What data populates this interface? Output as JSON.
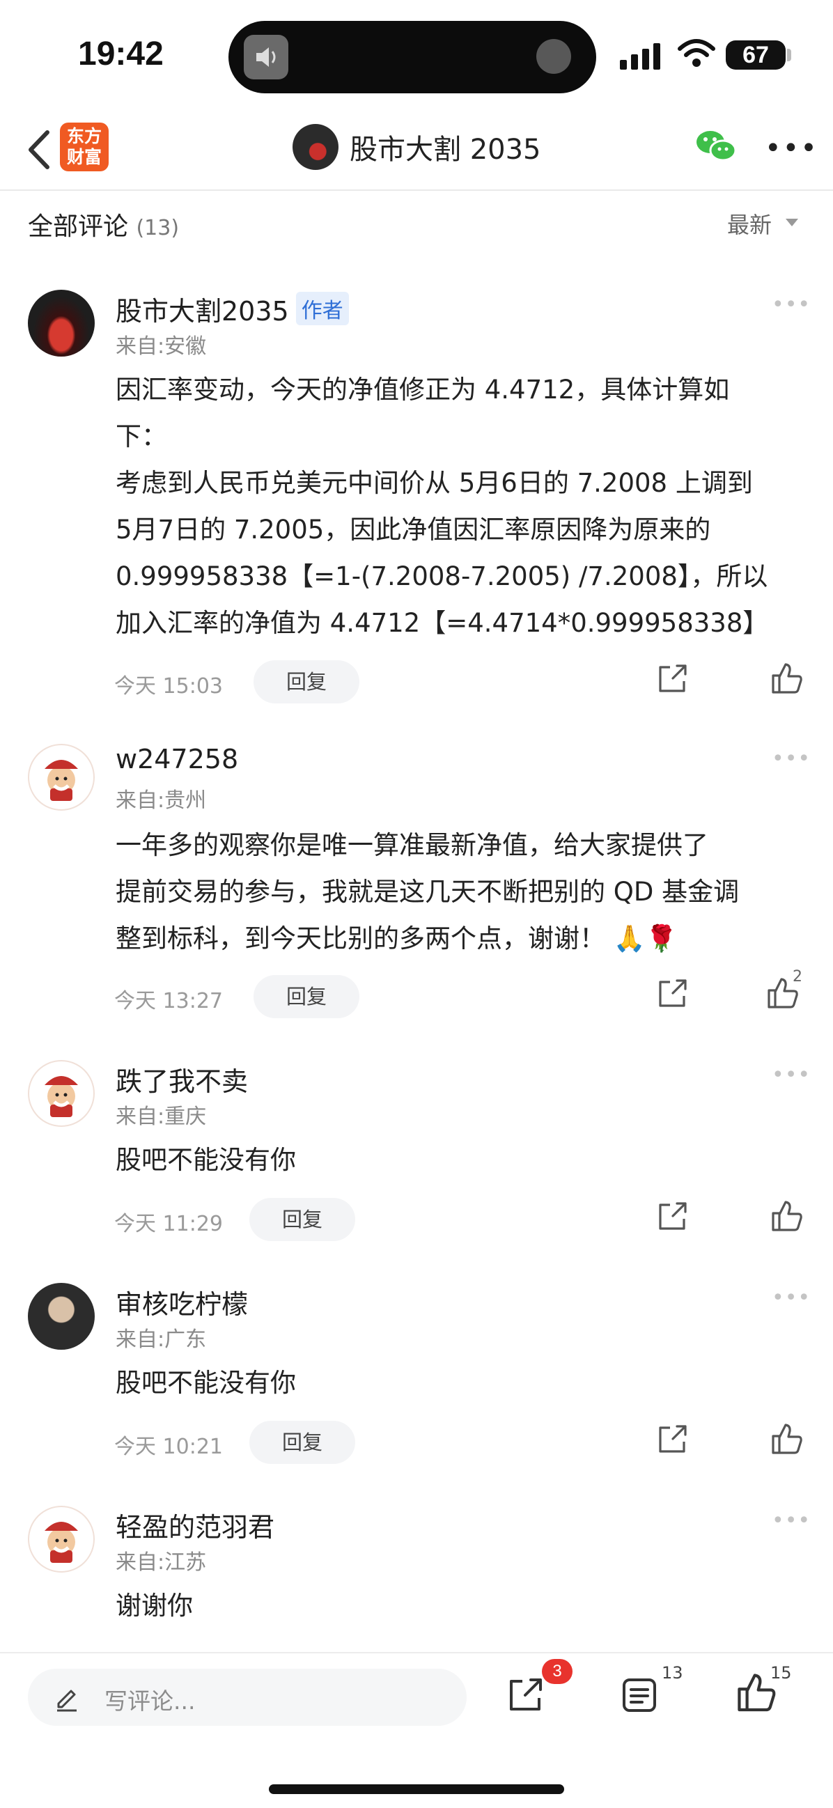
{
  "status_bar": {
    "time": "19:42",
    "battery": "67"
  },
  "nav": {
    "logo_line1": "东方",
    "logo_line2": "财富",
    "title": "股市大割 2035"
  },
  "section": {
    "title": "全部评论",
    "count": "(13)",
    "sort_label": "最新"
  },
  "comments": [
    {
      "user": "股市大割2035",
      "tag": "作者",
      "location": "来自:安徽",
      "lines": [
        "因汇率变动，今天的净值修正为 4.4712，具体计算如",
        "下：",
        "考虑到人民币兑美元中间价从 5月6日的 7.2008 上调到",
        "5月7日的 7.2005，因此净值因汇率原因降为原来的",
        "0.999958338【=1-(7.2008-7.2005) /7.2008】，所以",
        "加入汇率的净值为 4.4712【=4.4714*0.999958338】"
      ],
      "time": "今天 15:03",
      "reply_label": "回复",
      "likes": ""
    },
    {
      "user": "w247258",
      "tag": "",
      "location": "来自:贵州",
      "lines": [
        "一年多的观察你是唯一算准最新净值，给大家提供了",
        "提前交易的参与，我就是这几天不断把别的 QD 基金调",
        "整到标科，到今天比别的多两个点，谢谢！ 🙏🌹"
      ],
      "time": "今天 13:27",
      "reply_label": "回复",
      "likes": "2"
    },
    {
      "user": "跌了我不卖",
      "tag": "",
      "location": "来自:重庆",
      "lines": [
        "股吧不能没有你"
      ],
      "time": "今天 11:29",
      "reply_label": "回复",
      "likes": ""
    },
    {
      "user": "审核吃柠檬",
      "tag": "",
      "location": "来自:广东",
      "lines": [
        "股吧不能没有你"
      ],
      "time": "今天 10:21",
      "reply_label": "回复",
      "likes": ""
    },
    {
      "user": "轻盈的范羽君",
      "tag": "",
      "location": "来自:江苏",
      "lines": [
        "谢谢你"
      ],
      "time": "",
      "reply_label": "",
      "likes": ""
    }
  ],
  "bottom_bar": {
    "input_placeholder": "写评论...",
    "share_badge": "3",
    "comment_count": "13",
    "like_count": "15"
  },
  "icons": [
    "back-icon",
    "wechat-icon",
    "more-icon",
    "share-icon",
    "like-icon",
    "pen-icon",
    "comment-list-icon"
  ],
  "colors": {
    "brand_orange": "#f05a22",
    "author_tag": "#2f6fd6",
    "badge_red": "#e8332d"
  }
}
